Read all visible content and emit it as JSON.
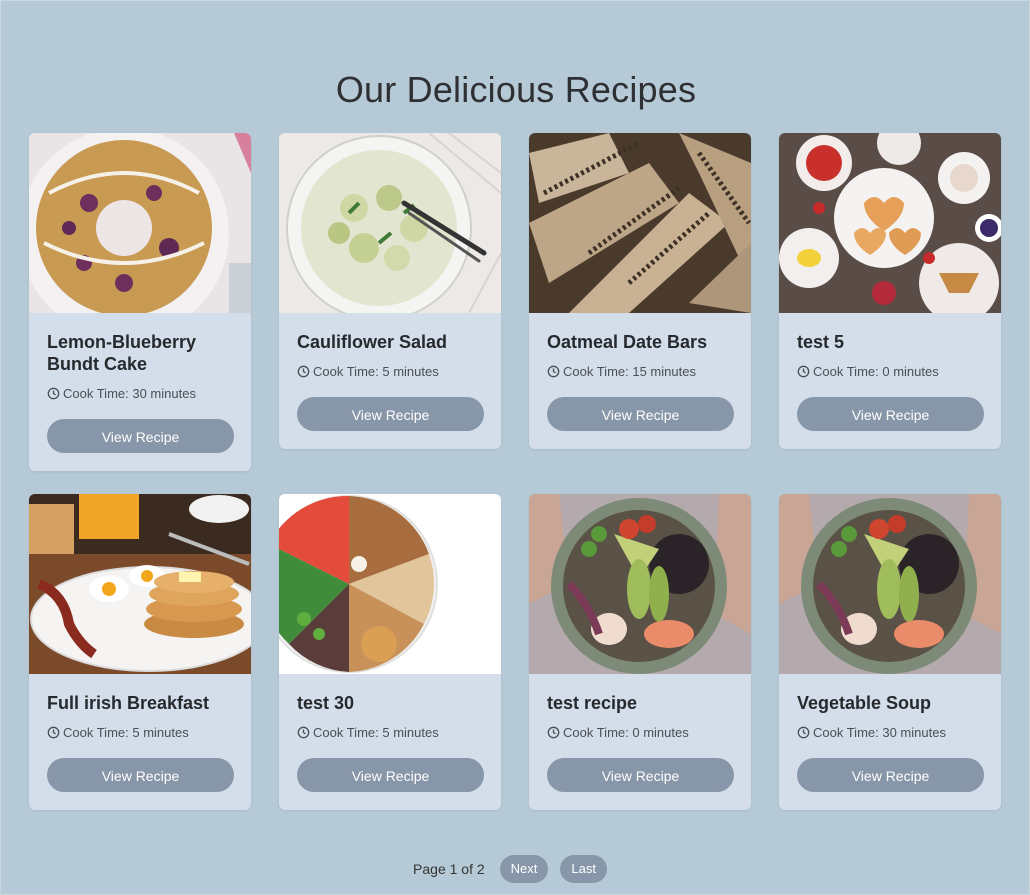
{
  "page": {
    "title": "Our Delicious Recipes"
  },
  "recipes": [
    {
      "name": "Lemon-Blueberry Bundt Cake",
      "cook_time": "Cook Time: 30 minutes",
      "button": "View Recipe"
    },
    {
      "name": "Cauliflower Salad",
      "cook_time": "Cook Time: 5 minutes",
      "button": "View Recipe"
    },
    {
      "name": "Oatmeal Date Bars",
      "cook_time": "Cook Time: 15 minutes",
      "button": "View Recipe"
    },
    {
      "name": "test 5",
      "cook_time": "Cook Time: 0 minutes",
      "button": "View Recipe"
    },
    {
      "name": "Full irish Breakfast",
      "cook_time": "Cook Time: 5 minutes",
      "button": "View Recipe"
    },
    {
      "name": "test 30",
      "cook_time": "Cook Time: 5 minutes",
      "button": "View Recipe"
    },
    {
      "name": "test recipe",
      "cook_time": "Cook Time: 0 minutes",
      "button": "View Recipe"
    },
    {
      "name": "Vegetable Soup",
      "cook_time": "Cook Time: 30 minutes",
      "button": "View Recipe"
    }
  ],
  "pagination": {
    "label": "Page 1 of 2",
    "next": "Next",
    "last": "Last"
  },
  "icons": {
    "cook_time": "clock-icon"
  }
}
